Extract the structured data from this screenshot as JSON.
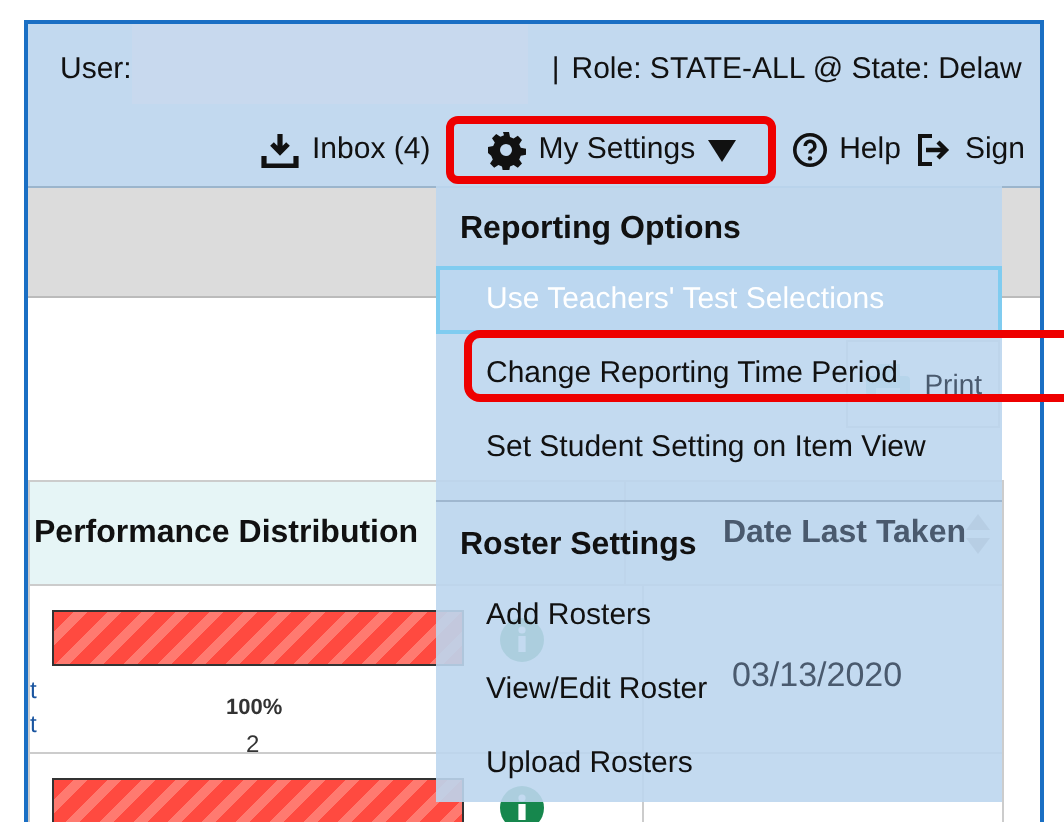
{
  "header": {
    "user_label": "User:",
    "separator": "|",
    "role": "Role: STATE-ALL @ State: Delaw"
  },
  "nav": [
    {
      "kind": "inbox",
      "label": "Inbox (4)",
      "annotated": false
    },
    {
      "kind": "settings",
      "label": "My Settings",
      "annotated": true
    },
    {
      "kind": "help",
      "label": "Help",
      "annotated": false
    },
    {
      "kind": "signout",
      "label": "Sign",
      "annotated": false
    }
  ],
  "print_button": {
    "label": "Print"
  },
  "table": {
    "columns": [
      "Performance Distribution",
      "Date Last Taken"
    ],
    "rows": [
      {
        "column_1_lines": [
          "t",
          "t"
        ],
        "level": 1,
        "percent": "100%",
        "count": "2",
        "date": "03/13/2020"
      },
      {
        "column_1_lines": [],
        "level": 1
      }
    ]
  },
  "menu": {
    "sections": [
      {
        "title": "Reporting Options",
        "items": [
          {
            "label": "Use Teachers' Test Selections",
            "selected": true,
            "annotated": false
          },
          {
            "label": "Change Reporting Time Period",
            "selected": false,
            "annotated": true
          },
          {
            "label": "Set Student Setting on Item View",
            "selected": false,
            "annotated": false
          }
        ]
      },
      {
        "title": "Roster Settings",
        "items": [
          {
            "label": "Add Rosters",
            "selected": false,
            "annotated": false
          },
          {
            "label": "View/Edit Roster",
            "selected": false,
            "annotated": false
          },
          {
            "label": "Upload Rosters",
            "selected": false,
            "annotated": false
          }
        ]
      }
    ]
  }
}
